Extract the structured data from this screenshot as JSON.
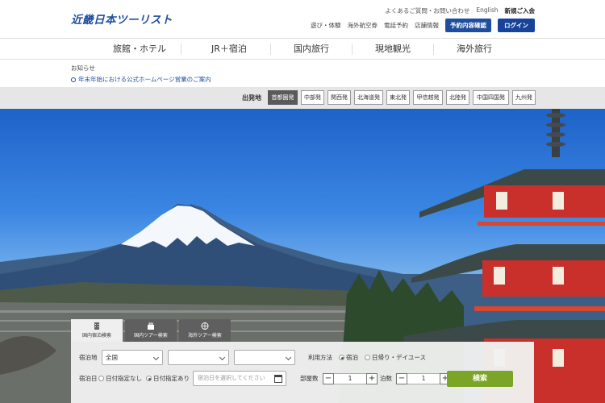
{
  "header": {
    "logo": "近畿日本ツーリスト",
    "util_top": [
      "よくあるご質問・お問い合わせ",
      "English",
      "新規ご入会"
    ],
    "util_bottom": [
      "遊び・体験",
      "海外航空券",
      "電話予約",
      "店舗情報"
    ],
    "reservation_button": "予約内容確認",
    "login_button": "ログイン",
    "brand_color": "#1f4e9e"
  },
  "gnav": [
    "旅館・ホテル",
    "JR＋宿泊",
    "国内旅行",
    "現地観光",
    "海外旅行"
  ],
  "notice": {
    "title": "お知らせ",
    "link": "年末年始における公式ホームページ営業のご案内"
  },
  "departure": {
    "label": "出発地",
    "options": [
      "首都圏発",
      "中部発",
      "関西発",
      "北海道発",
      "東北発",
      "甲信越発",
      "北陸発",
      "中国四国発",
      "九州発"
    ],
    "selected": "首都圏発"
  },
  "search": {
    "tabs": [
      "国内宿泊検索",
      "国内ツアー検索",
      "海外ツアー検索"
    ],
    "active_tab": "国内宿泊検索",
    "destination_label": "宿泊地",
    "destination_value": "全国",
    "usage_label": "利用方法",
    "usage_options": [
      "宿泊",
      "日帰り・デイユース"
    ],
    "usage_selected": "宿泊",
    "date_label": "宿泊日",
    "date_options": [
      "日付指定なし",
      "日付指定あり"
    ],
    "date_selected": "日付指定あり",
    "date_placeholder": "宿泊日を選択してください",
    "rooms_label": "部屋数",
    "rooms_value": "1",
    "nights_label": "泊数",
    "nights_value": "1",
    "search_button": "検索",
    "search_color": "#7aa526"
  }
}
